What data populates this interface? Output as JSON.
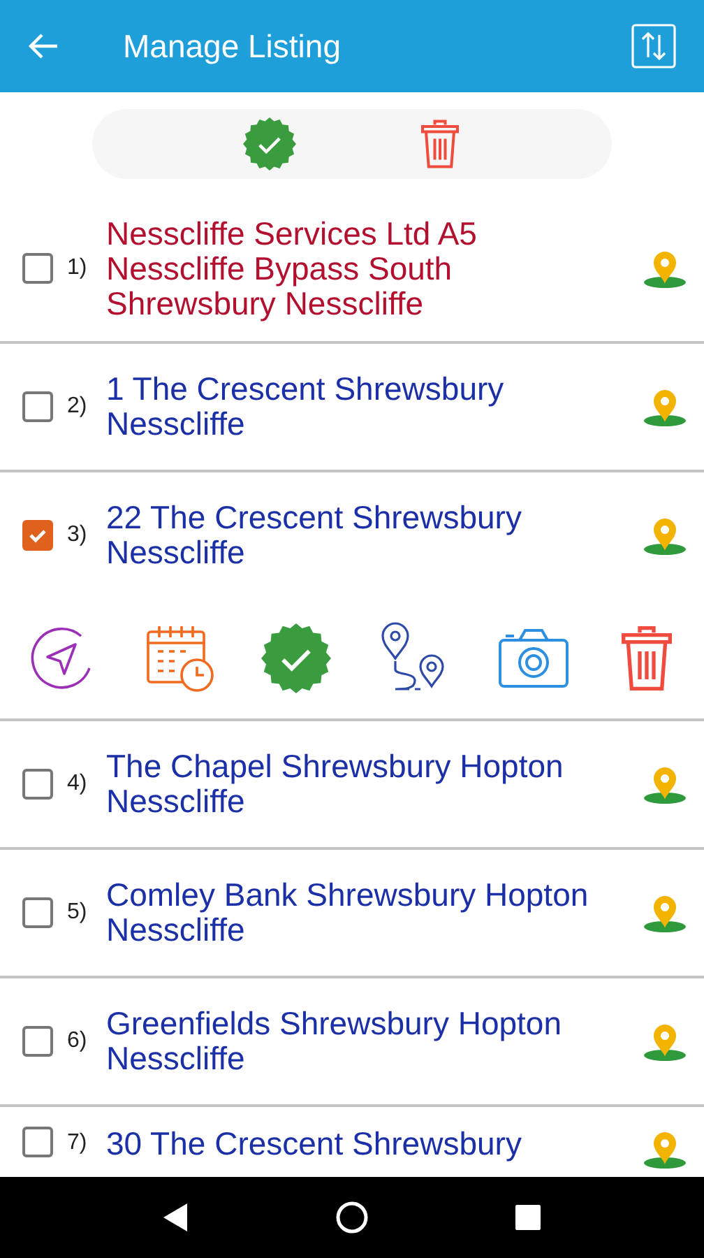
{
  "app_bar": {
    "title": "Manage Listing"
  },
  "listings": [
    {
      "number": "1)",
      "address": "Nesscliffe Services Ltd A5 Nesscliffe Bypass South Shrewsbury Nesscliffe",
      "color": "#b3102f",
      "checked": false,
      "expanded": false
    },
    {
      "number": "2)",
      "address": "1 The Crescent Shrewsbury Nesscliffe",
      "color": "#1b2fa6",
      "checked": false,
      "expanded": false
    },
    {
      "number": "3)",
      "address": "22 The Crescent Shrewsbury Nesscliffe",
      "color": "#1b2fa6",
      "checked": true,
      "expanded": true
    },
    {
      "number": "4)",
      "address": "The Chapel Shrewsbury Hopton Nesscliffe",
      "color": "#1b2fa6",
      "checked": false,
      "expanded": false
    },
    {
      "number": "5)",
      "address": "Comley Bank Shrewsbury Hopton Nesscliffe",
      "color": "#1b2fa6",
      "checked": false,
      "expanded": false
    },
    {
      "number": "6)",
      "address": "Greenfields Shrewsbury Hopton Nesscliffe",
      "color": "#1b2fa6",
      "checked": false,
      "expanded": false
    },
    {
      "number": "7)",
      "address": "30 The Crescent Shrewsbury",
      "color": "#1b2fa6",
      "checked": false,
      "expanded": false
    }
  ]
}
